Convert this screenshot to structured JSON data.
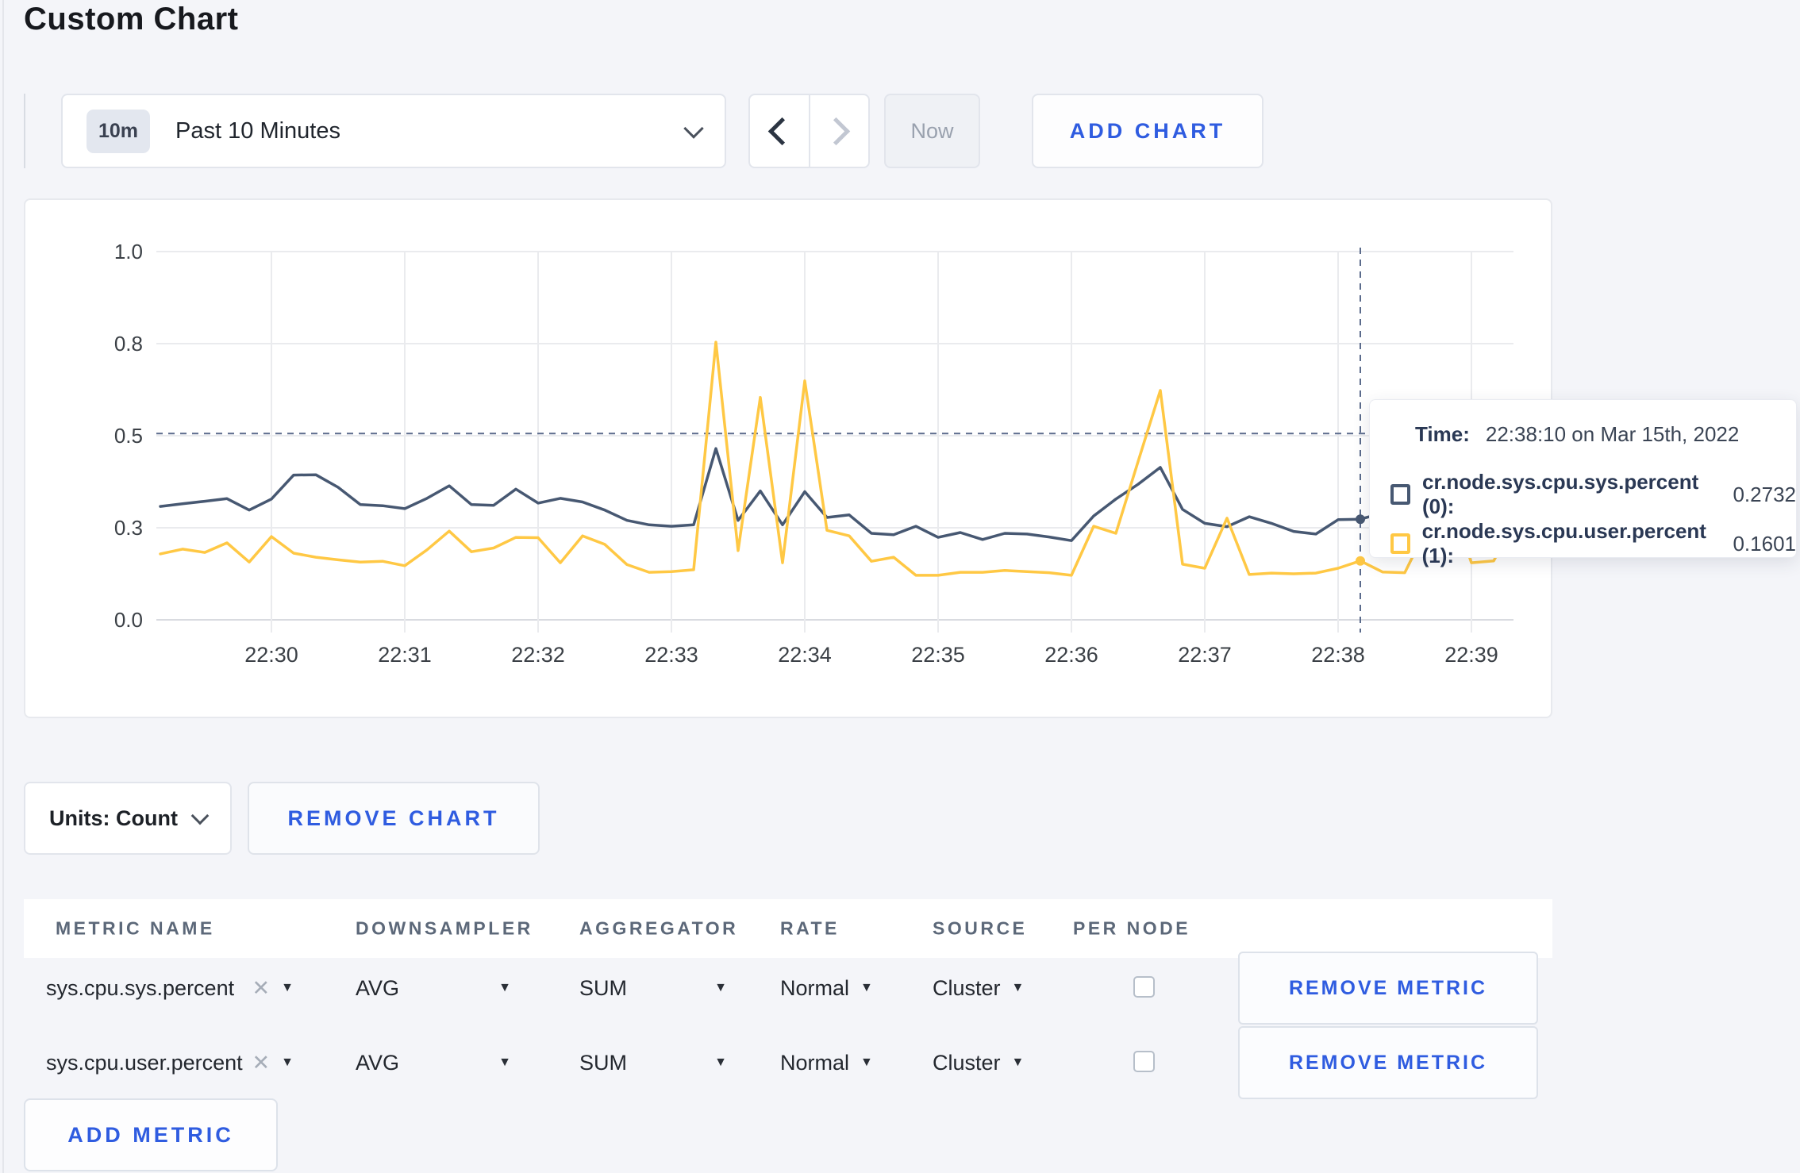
{
  "page": {
    "title": "Custom Chart"
  },
  "toolbar": {
    "time_range": {
      "badge": "10m",
      "label": "Past 10 Minutes"
    },
    "now_label": "Now",
    "add_chart_label": "ADD CHART"
  },
  "chart_data": {
    "type": "line",
    "title": "",
    "xlabel": "",
    "ylabel": "",
    "ylim": [
      0,
      1
    ],
    "grid": true,
    "start_time": "22:29:10",
    "interval_seconds": 10,
    "x_ticks": [
      {
        "label": "22:30",
        "offset_s": 50
      },
      {
        "label": "22:31",
        "offset_s": 110
      },
      {
        "label": "22:32",
        "offset_s": 170
      },
      {
        "label": "22:33",
        "offset_s": 230
      },
      {
        "label": "22:34",
        "offset_s": 290
      },
      {
        "label": "22:35",
        "offset_s": 350
      },
      {
        "label": "22:36",
        "offset_s": 410
      },
      {
        "label": "22:37",
        "offset_s": 470
      },
      {
        "label": "22:38",
        "offset_s": 530
      },
      {
        "label": "22:39",
        "offset_s": 590
      }
    ],
    "y_ticks": [
      {
        "pos": 0.0,
        "label": "0.0"
      },
      {
        "pos": 0.25,
        "label": "0.3"
      },
      {
        "pos": 0.5,
        "label": "0.5"
      },
      {
        "pos": 0.75,
        "label": "0.8"
      },
      {
        "pos": 1.0,
        "label": "1.0"
      }
    ],
    "series": [
      {
        "name": "cr.node.sys.cpu.sys.percent (0)",
        "color": "#475872",
        "values": [
          0.308,
          0.315,
          0.322,
          0.329,
          0.298,
          0.328,
          0.393,
          0.394,
          0.36,
          0.313,
          0.31,
          0.302,
          0.33,
          0.364,
          0.313,
          0.311,
          0.355,
          0.317,
          0.33,
          0.32,
          0.298,
          0.27,
          0.258,
          0.254,
          0.258,
          0.465,
          0.27,
          0.35,
          0.258,
          0.348,
          0.278,
          0.285,
          0.235,
          0.231,
          0.254,
          0.224,
          0.237,
          0.218,
          0.235,
          0.233,
          0.225,
          0.215,
          0.282,
          0.328,
          0.368,
          0.414,
          0.3,
          0.262,
          0.253,
          0.28,
          0.262,
          0.24,
          0.233,
          0.272,
          0.2732,
          0.29,
          0.27,
          0.28,
          0.268,
          0.27,
          0.282,
          0.272
        ]
      },
      {
        "name": "cr.node.sys.cpu.user.percent (1)",
        "color": "#ffc844",
        "values": [
          0.179,
          0.192,
          0.183,
          0.209,
          0.157,
          0.226,
          0.181,
          0.17,
          0.163,
          0.157,
          0.159,
          0.147,
          0.19,
          0.241,
          0.185,
          0.195,
          0.224,
          0.223,
          0.155,
          0.228,
          0.205,
          0.15,
          0.129,
          0.131,
          0.136,
          0.754,
          0.188,
          0.604,
          0.155,
          0.649,
          0.243,
          0.228,
          0.159,
          0.17,
          0.121,
          0.121,
          0.129,
          0.129,
          0.134,
          0.131,
          0.128,
          0.121,
          0.254,
          0.235,
          0.43,
          0.623,
          0.151,
          0.14,
          0.276,
          0.123,
          0.127,
          0.125,
          0.127,
          0.14,
          0.1601,
          0.13,
          0.128,
          0.25,
          0.33,
          0.155,
          0.16,
          0.27
        ]
      }
    ],
    "crosshair": {
      "x_offset_s": 540,
      "hline_pos": 0.506,
      "color": "#5b6b8c"
    },
    "tooltip": {
      "time_label": "Time:",
      "time_value": "22:38:10 on Mar 15th, 2022",
      "rows": [
        {
          "series": "cr.node.sys.cpu.sys.percent (0):",
          "value": "0.2732",
          "color": "#475872"
        },
        {
          "series": "cr.node.sys.cpu.user.percent (1):",
          "value": "0.1601",
          "color": "#ffc844"
        }
      ]
    }
  },
  "controls": {
    "units_label": "Units: Count",
    "remove_chart_label": "REMOVE CHART"
  },
  "metrics_table": {
    "columns": [
      "METRIC NAME",
      "DOWNSAMPLER",
      "AGGREGATOR",
      "RATE",
      "SOURCE",
      "PER NODE"
    ],
    "rows": [
      {
        "metric": "sys.cpu.sys.percent",
        "downsampler": "AVG",
        "aggregator": "SUM",
        "rate": "Normal",
        "source": "Cluster",
        "per_node_checked": false,
        "remove_label": "REMOVE METRIC"
      },
      {
        "metric": "sys.cpu.user.percent",
        "downsampler": "AVG",
        "aggregator": "SUM",
        "rate": "Normal",
        "source": "Cluster",
        "per_node_checked": false,
        "remove_label": "REMOVE METRIC"
      }
    ],
    "add_metric_label": "ADD METRIC",
    "caret_glyph": "▼",
    "remove_selection_glyph": "✕"
  },
  "colors": {
    "accent_blue": "#2f5ce0",
    "page_bg": "#f4f5f9",
    "grid_line": "#eaebee",
    "axis_text": "#3b4046"
  }
}
